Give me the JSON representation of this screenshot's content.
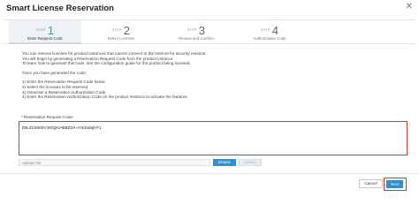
{
  "dialog": {
    "title": "Smart License Reservation",
    "close_glyph": "✕"
  },
  "wizard": {
    "steps": [
      {
        "label": "STEP",
        "number": "1",
        "name": "Enter Request Code",
        "active": true
      },
      {
        "label": "STEP",
        "number": "2",
        "name": "Select Licenses",
        "active": false
      },
      {
        "label": "STEP",
        "number": "3",
        "name": "Review and Confirm",
        "active": false
      },
      {
        "label": "STEP",
        "number": "4",
        "name": "Authorization Code",
        "active": false
      }
    ]
  },
  "instructions": {
    "line1": "You can reserve licenses for product instances that cannot connect to the Internet for security reasons.",
    "line2": "You will begin by generating a Reservation Request Code from the product instance.",
    "line3": "To learn how to generate this code, see the configuration guide for the product being licensed.",
    "generated_intro": "Once you have generated the code:",
    "step1": "1) Enter the Reservation Request Code below",
    "step2": "2) Select the licenses to be reserved",
    "step3": "3) Generate a Reservation Authorization Code",
    "step4": "4) Enter the Reservation Authorization Code on the product instance to activate the features"
  },
  "request_code": {
    "required_marker": "*",
    "label": "Reservation Request Code:",
    "value": "DB-ZC8000V:9GQKIABBZ1H-AYk3ndq6-F1"
  },
  "upload": {
    "placeholder": "Upload File",
    "browse_label": "Browse",
    "upload_label": "Upload"
  },
  "footer": {
    "cancel_label": "Cancel",
    "next_label": "Next"
  },
  "colors": {
    "accent": "#2f8fd0",
    "highlight": "#d9362b",
    "step_active": "#2c9fd6"
  }
}
